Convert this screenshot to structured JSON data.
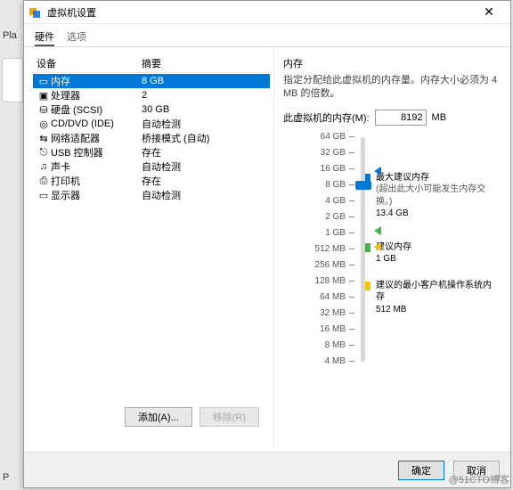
{
  "bg": {
    "player": "Pla",
    "p": "P"
  },
  "titlebar": {
    "title": "虚拟机设置"
  },
  "tabs": {
    "hardware": "硬件",
    "options": "选项"
  },
  "list": {
    "header_device": "设备",
    "header_summary": "摘要",
    "items": [
      {
        "icon": "memory-icon",
        "glyph": "▭",
        "name": "内存",
        "summary": "8 GB",
        "selected": true
      },
      {
        "icon": "cpu-icon",
        "glyph": "▣",
        "name": "处理器",
        "summary": "2"
      },
      {
        "icon": "disk-icon",
        "glyph": "⛁",
        "name": "硬盘 (SCSI)",
        "summary": "30 GB"
      },
      {
        "icon": "cd-dvd-icon",
        "glyph": "◎",
        "name": "CD/DVD (IDE)",
        "summary": "自动检测"
      },
      {
        "icon": "network-icon",
        "glyph": "⇆",
        "name": "网络适配器",
        "summary": "桥接模式 (自动)"
      },
      {
        "icon": "usb-icon",
        "glyph": "⎋",
        "name": "USB 控制器",
        "summary": "存在"
      },
      {
        "icon": "sound-icon",
        "glyph": "♫",
        "name": "声卡",
        "summary": "自动检测"
      },
      {
        "icon": "printer-icon",
        "glyph": "⎙",
        "name": "打印机",
        "summary": "存在"
      },
      {
        "icon": "display-icon",
        "glyph": "▭",
        "name": "显示器",
        "summary": "自动检测"
      }
    ]
  },
  "right": {
    "heading": "内存",
    "desc": "指定分配给此虚拟机的内存量。内存大小必须为 4 MB 的倍数。",
    "label": "此虚拟机的内存(M):",
    "value": "8192",
    "unit": "MB"
  },
  "scale": {
    "ticks": [
      "64 GB",
      "32 GB",
      "16 GB",
      "8 GB",
      "4 GB",
      "2 GB",
      "1 GB",
      "512 MB",
      "256 MB",
      "128 MB",
      "64 MB",
      "32 MB",
      "16 MB",
      "8 MB",
      "4 MB"
    ]
  },
  "legend": {
    "max_title": "最大建议内存",
    "max_sub": "(超出此大小可能发生内存交换。)",
    "max_val": "13.4 GB",
    "rec_title": "建议内存",
    "rec_val": "1 GB",
    "min_title": "建议的最小客户机操作系统内存",
    "min_val": "512 MB"
  },
  "buttons": {
    "add": "添加(A)...",
    "remove": "移除(R)",
    "ok": "确定",
    "cancel": "取消"
  },
  "watermark": "@51CTO博客"
}
